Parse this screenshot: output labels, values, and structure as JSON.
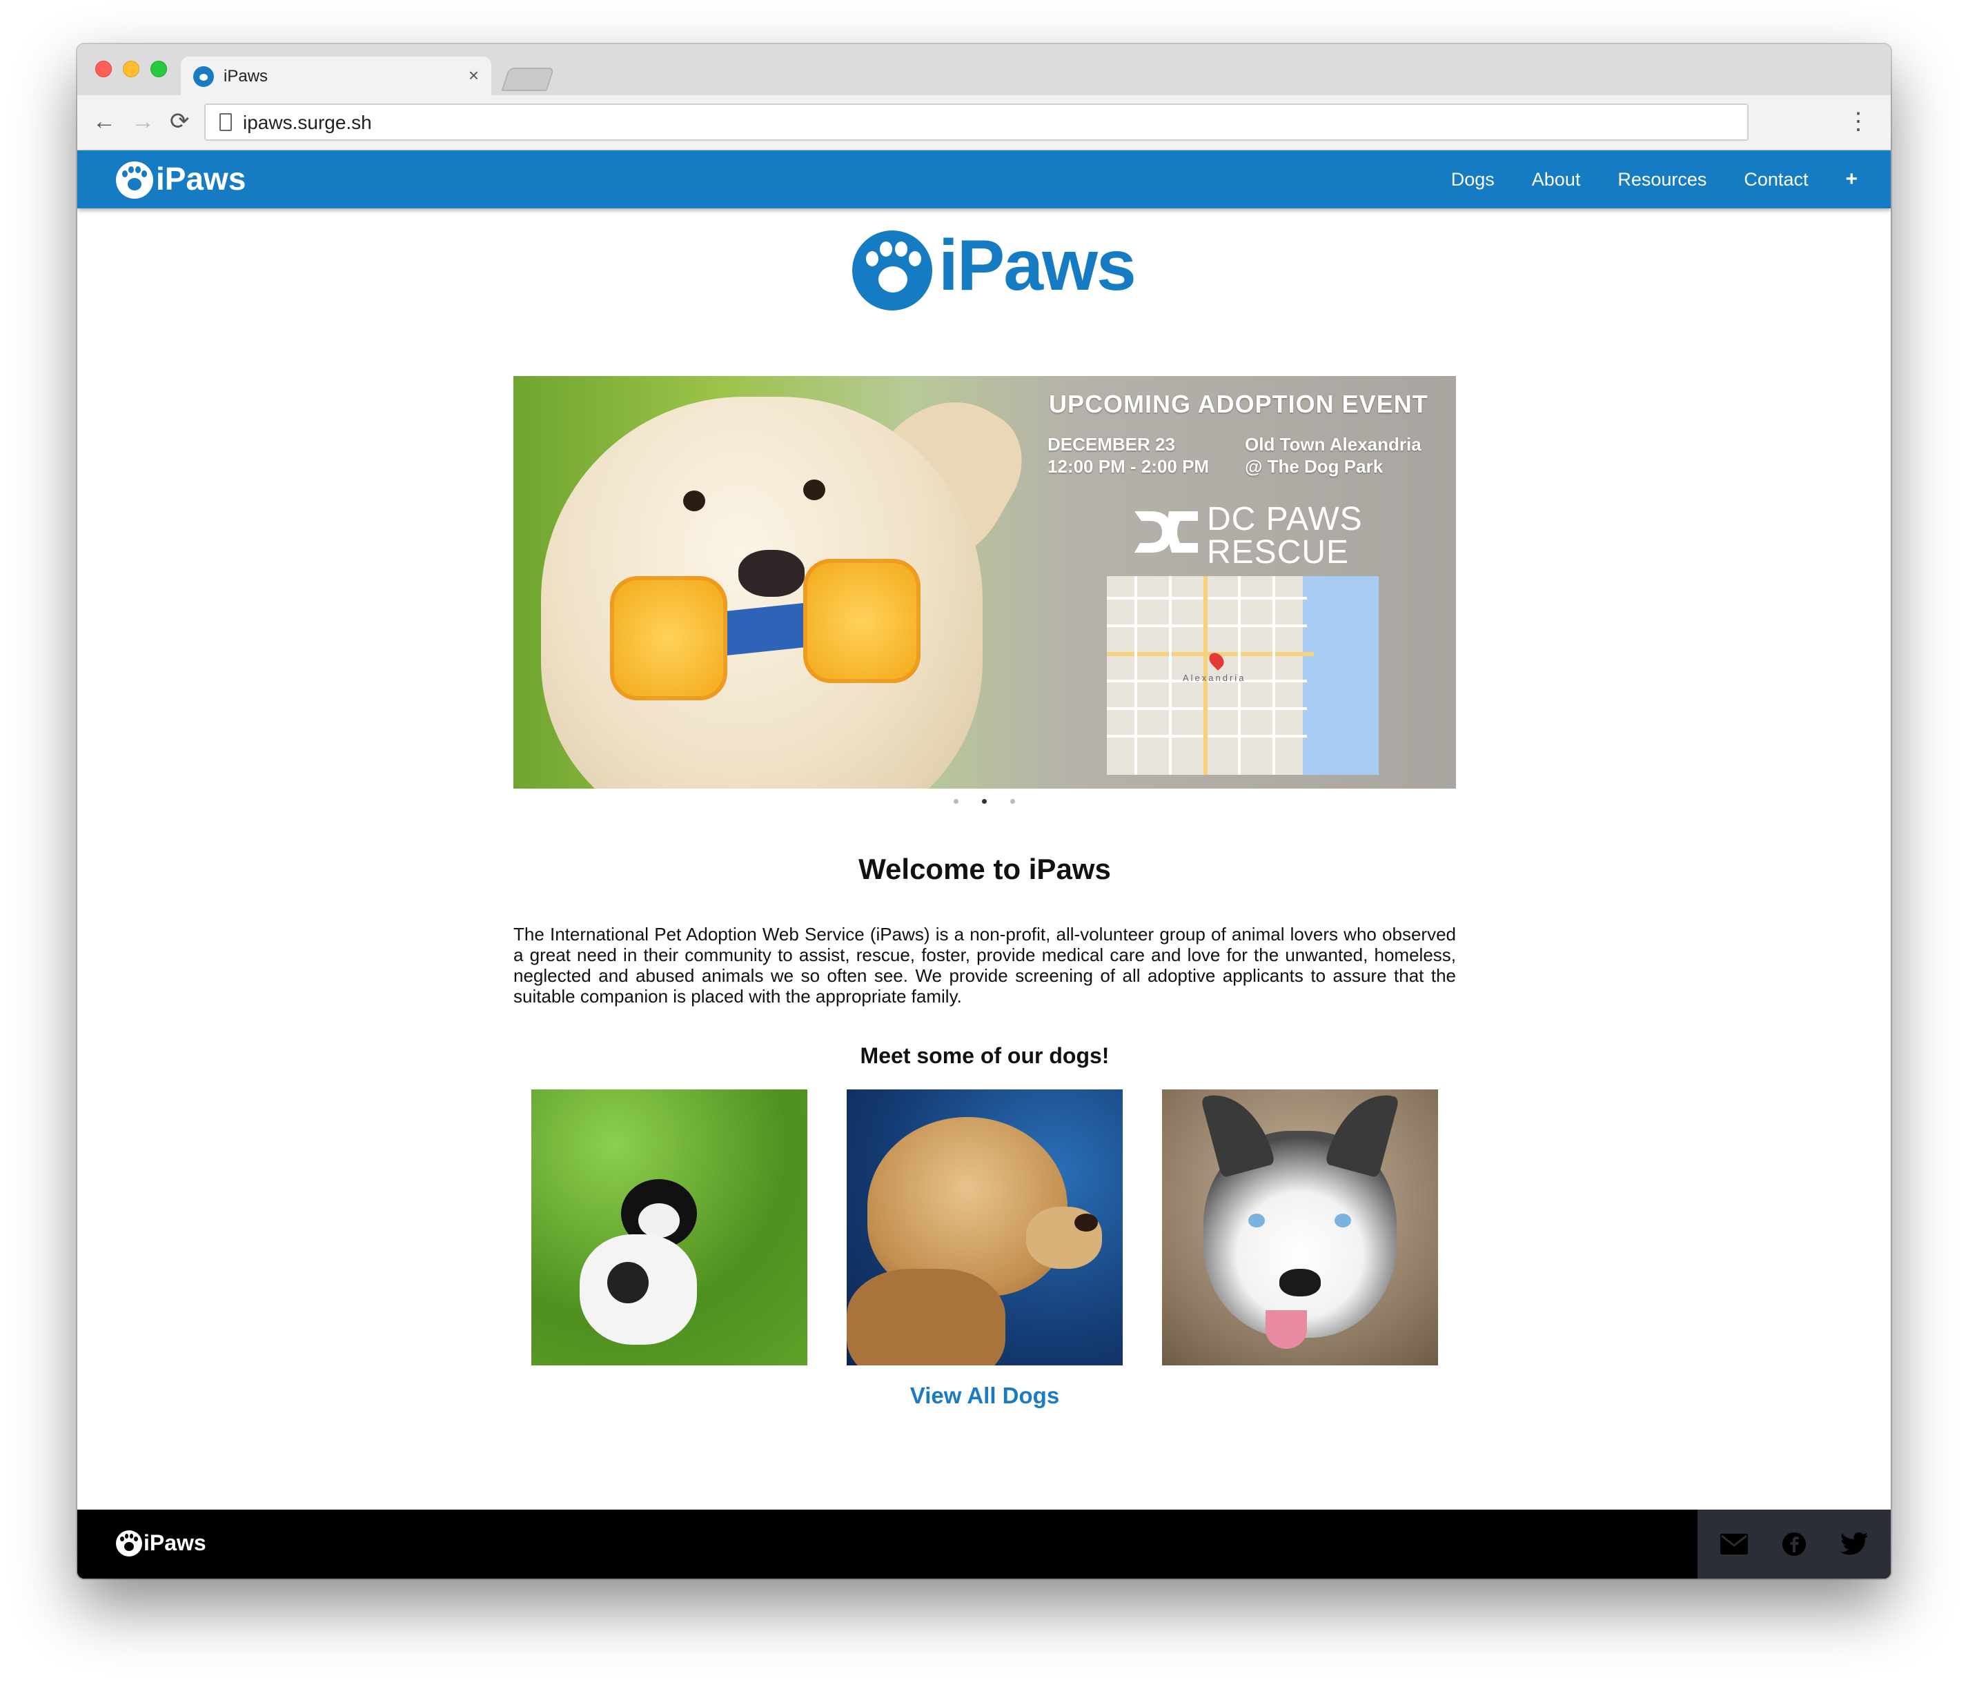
{
  "browser": {
    "tab_title": "iPaws",
    "tab_close": "×",
    "url": "ipaws.surge.sh",
    "back": "←",
    "forward": "→",
    "reload": "⟳",
    "menu": "⋮"
  },
  "nav": {
    "brand": "iPaws",
    "links": [
      "Dogs",
      "About",
      "Resources",
      "Contact"
    ],
    "plus": "+"
  },
  "hero": {
    "brand": "iPaws"
  },
  "carousel": {
    "event_title": "UPCOMING ADOPTION EVENT",
    "date": "DECEMBER 23",
    "time": "12:00 PM - 2:00 PM",
    "location_line1": "Old Town Alexandria",
    "location_line2": "@ The Dog Park",
    "partner_line1": "DC PAWS",
    "partner_line2": "RESCUE",
    "map_label": "Alexandria",
    "slide_count": 3,
    "active_slide": 2
  },
  "main": {
    "welcome": "Welcome to iPaws",
    "intro": "The International Pet Adoption Web Service (iPaws) is a non-profit, all-volunteer group of animal lovers who observed a great need in their community to assist, rescue, foster, provide medical care and love for the unwanted, homeless, neglected and abused animals we so often see.  We provide screening of all adoptive applicants to assure that the suitable companion is placed with the appropriate family.",
    "meet": "Meet some of our dogs!",
    "view_all": "View All Dogs"
  },
  "footer": {
    "brand": "iPaws",
    "icons": [
      "mail-icon",
      "facebook-icon",
      "twitter-icon"
    ]
  },
  "colors": {
    "brand_blue": "#157bc2",
    "footer_black": "#000000",
    "footer_social_bg": "#2a2e36"
  }
}
